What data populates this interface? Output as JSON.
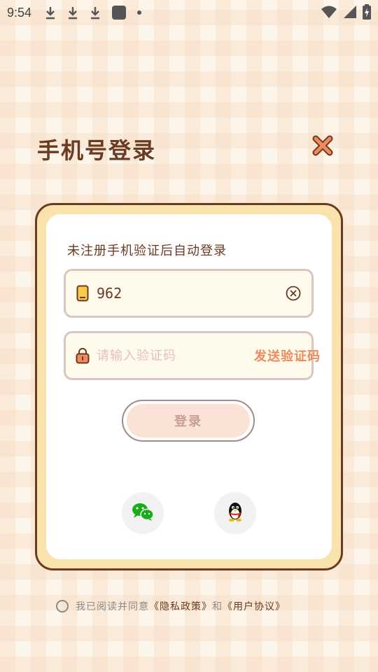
{
  "status_bar": {
    "time": "9:54",
    "left_icons": [
      "download-icon",
      "download-icon",
      "download-icon",
      "app-square-icon",
      "dot-icon"
    ],
    "right_icons": [
      "wifi-icon",
      "signal-icon",
      "battery-charging-icon"
    ]
  },
  "page": {
    "title": "手机号登录"
  },
  "form": {
    "hint": "未注册手机验证后自动登录",
    "phone_value": "962",
    "code_placeholder": "请输入验证码",
    "send_code_label": "发送验证码",
    "login_label": "登录"
  },
  "social": [
    "wechat-icon",
    "qq-icon"
  ],
  "agreement": {
    "prefix": "我已阅读并同意",
    "privacy_link": "《隐私政策》",
    "and_text": "和",
    "terms_link": "《用户协议》"
  },
  "colors": {
    "brown": "#6b3a22",
    "card_yellow": "#f9e2ac",
    "accent_orange": "#ee8a5c",
    "login_pink": "#fbe2d6"
  }
}
